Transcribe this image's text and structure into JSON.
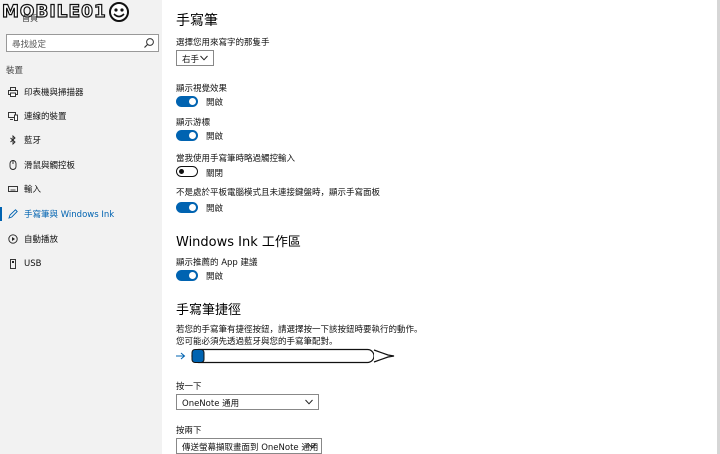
{
  "sidebar": {
    "logo_text": "MOBILE01",
    "home_label": "首頁",
    "search_placeholder": "尋找設定",
    "section_title": "裝置",
    "items": [
      {
        "label": "印表機與掃描器",
        "icon": "printer-icon"
      },
      {
        "label": "連線的裝置",
        "icon": "devices-icon"
      },
      {
        "label": "藍牙",
        "icon": "bluetooth-icon"
      },
      {
        "label": "滑鼠與觸控板",
        "icon": "mouse-icon"
      },
      {
        "label": "輸入",
        "icon": "keyboard-icon"
      },
      {
        "label": "手寫筆與 Windows Ink",
        "icon": "pen-icon",
        "active": true
      },
      {
        "label": "自動播放",
        "icon": "autoplay-icon"
      },
      {
        "label": "USB",
        "icon": "usb-icon"
      }
    ]
  },
  "main": {
    "title": "手寫筆",
    "hand_label": "選擇您用來寫字的那隻手",
    "hand_value": "右手",
    "toggles": [
      {
        "label": "顯示視覺效果",
        "state": "開啟",
        "on": true
      },
      {
        "label": "顯示游標",
        "state": "開啟",
        "on": true
      },
      {
        "label": "當我使用手寫筆時略過觸控輸入",
        "state": "關閉",
        "on": false
      },
      {
        "label": "不是處於平板電腦模式且未連接鍵盤時，顯示手寫面板",
        "state": "開啟",
        "on": true
      }
    ],
    "ink_title": "Windows Ink 工作區",
    "ink_toggle": {
      "label": "顯示推薦的 App 建議",
      "state": "開啟",
      "on": true
    },
    "shortcuts_title": "手寫筆捷徑",
    "shortcuts_desc_1": "若您的手寫筆有捷徑按鈕，請選擇按一下該按鈕時要執行的動作。",
    "shortcuts_desc_2": "您可能必須先透過藍牙與您的手寫筆配對。",
    "click_once_label": "按一下",
    "click_once_value": "OneNote 通用",
    "double_click_label": "按兩下",
    "double_click_value": "傳送螢幕擷取畫面到 OneNote 通用"
  },
  "colors": {
    "accent": "#0063b1",
    "sidebar_bg": "#f2f2f2"
  }
}
